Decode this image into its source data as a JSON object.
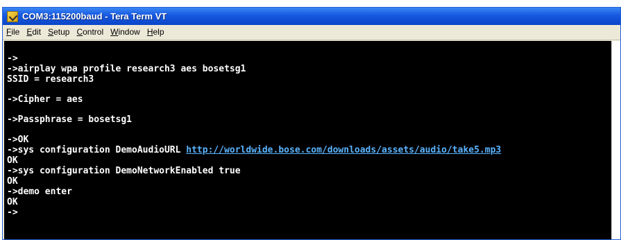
{
  "window": {
    "title": "COM3:115200baud - Tera Term VT"
  },
  "menu": {
    "items": [
      {
        "key": "F",
        "rest": "ile"
      },
      {
        "key": "E",
        "rest": "dit"
      },
      {
        "key": "S",
        "rest": "etup"
      },
      {
        "key": "C",
        "rest": "ontrol"
      },
      {
        "key": "W",
        "rest": "indow"
      },
      {
        "key": "H",
        "rest": "elp"
      }
    ]
  },
  "terminal": {
    "l1": "->",
    "l2": "->airplay wpa profile research3 aes bosetsg1",
    "l3": "SSID = research3",
    "l4": "->Cipher = aes",
    "l5": "->Passphrase = bosetsg1",
    "l6": "->OK",
    "l7_prefix": "->sys configuration DemoAudioURL ",
    "l7_link": "http://worldwide.bose.com/downloads/assets/audio/take5.mp3",
    "l8": "OK",
    "l9": "->sys configuration DemoNetworkEnabled true",
    "l10": "OK",
    "l11": "->demo enter",
    "l12": "OK",
    "l13": "->"
  }
}
